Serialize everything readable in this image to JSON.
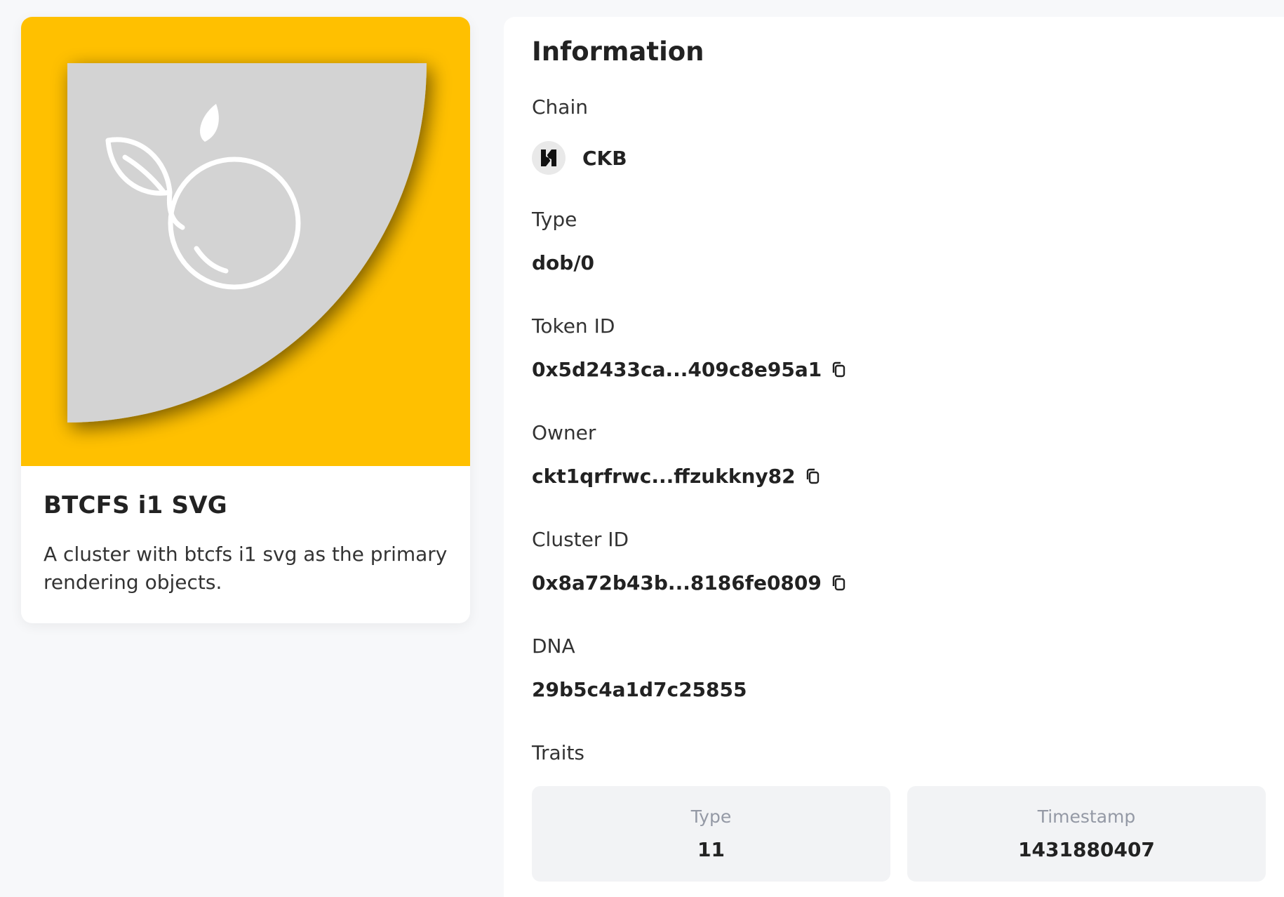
{
  "nft": {
    "name": "BTCFS i1 SVG",
    "description": "A cluster with btcfs i1 svg as the primary rendering objects.",
    "media": {
      "background_color": "#ffc000",
      "shape_color": "#d3d3d3",
      "icon": "fruit-leaf-icon"
    }
  },
  "info": {
    "title": "Information",
    "fields": {
      "chain": {
        "label": "Chain",
        "value": "CKB",
        "icon": "ckb-logo-icon"
      },
      "type": {
        "label": "Type",
        "value": "dob/0"
      },
      "token_id": {
        "label": "Token ID",
        "value": "0x5d2433ca...409c8e95a1",
        "icon": "copy-icon"
      },
      "owner": {
        "label": "Owner",
        "value": "ckt1qrfrwc...ffzukkny82",
        "icon": "copy-icon"
      },
      "cluster_id": {
        "label": "Cluster ID",
        "value": "0x8a72b43b...8186fe0809",
        "icon": "copy-icon"
      },
      "dna": {
        "label": "DNA",
        "value": "29b5c4a1d7c25855"
      },
      "traits": {
        "label": "Traits"
      }
    },
    "traits": [
      {
        "name": "Type",
        "value": "11"
      },
      {
        "name": "Timestamp",
        "value": "1431880407"
      }
    ]
  }
}
